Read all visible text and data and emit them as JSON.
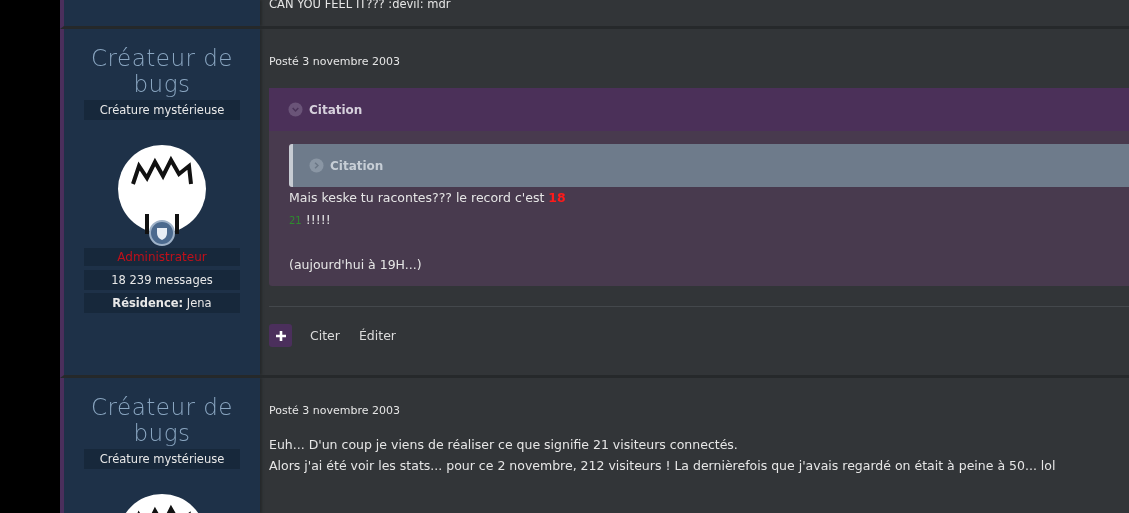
{
  "posts": [
    {
      "kind": "tail",
      "body": [
        "CAN YOU FEEL IT??? :devil: mdr"
      ]
    },
    {
      "kind": "full",
      "author": "Créateur de bugs",
      "rank": "Créature mystérieuse",
      "role": "Administrateur",
      "count": "18 239 messages",
      "residence_label": "Résidence:",
      "residence": "Jena",
      "date": "Posté 3 novembre 2003",
      "quote": {
        "title": "Citation",
        "expanded": true,
        "inner": {
          "title": "Citation",
          "expanded": false
        },
        "lines": [
          {
            "parts": [
              {
                "text": "Mais keske tu racontes??? le record c'est "
              },
              {
                "text": "18",
                "color": "#ff1a1a",
                "bold": true
              }
            ]
          },
          {
            "parts": [
              {
                "text": "21",
                "color": "#2e8b2e",
                "small": true
              },
              {
                "text": " !!!!!"
              }
            ]
          },
          {
            "parts": [
              {
                "text": "(aujourd'hui à 19H...)"
              }
            ]
          }
        ]
      },
      "actions": [
        "Citer",
        "Éditer"
      ]
    },
    {
      "kind": "partial",
      "author": "Créateur de bugs",
      "rank": "Créature mystérieuse",
      "date": "Posté 3 novembre 2003",
      "body": [
        "Euh... D'un coup je viens de réaliser ce que signifie 21 visiteurs connectés.",
        "Alors j'ai été voir les stats... pour ce 2 novembre, 212 visiteurs ! La dernièrefois que j'avais regardé on était à peine à 50... lol"
      ]
    }
  ]
}
